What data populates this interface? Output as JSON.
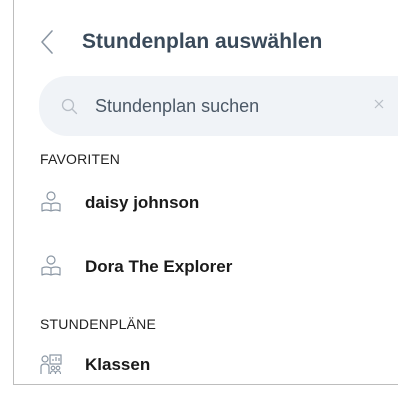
{
  "header": {
    "title": "Stundenplan auswählen",
    "back_icon": "chevron-left-icon"
  },
  "search": {
    "placeholder": "Stundenplan suchen",
    "value": "",
    "search_icon": "search-icon",
    "clear_icon": "close-icon"
  },
  "favorites": {
    "heading": "FAVORITEN",
    "items": [
      {
        "label": "daisy johnson",
        "icon": "student-reading-icon"
      },
      {
        "label": "Dora The Explorer",
        "icon": "student-reading-icon"
      }
    ]
  },
  "timetables": {
    "heading": "STUNDENPLÄNE",
    "items": [
      {
        "label": "Klassen",
        "icon": "classroom-icon"
      }
    ]
  },
  "colors": {
    "title": "#3a4a5a",
    "search_background": "#f0f3f7",
    "icon_stroke": "#8a96a3",
    "text": "#1a1a1a"
  }
}
